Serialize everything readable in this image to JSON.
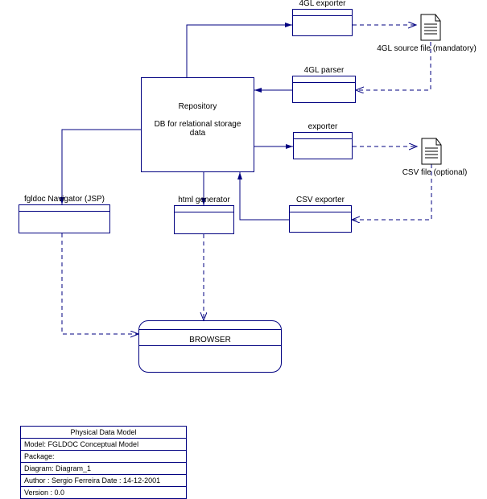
{
  "components": {
    "fourgl_exporter": "4GL exporter",
    "fourgl_parser": "4GL parser",
    "exporter": "exporter",
    "csv_exporter": "CSV exporter",
    "html_generator": "html generator",
    "fgldoc_navigator": "fgldoc Navigator (JSP)"
  },
  "repository": {
    "title": "Repository",
    "subtitle": "DB for relational storage data"
  },
  "files": {
    "fourgl_source": "4GL source file (mandatory)",
    "csv_file": "CSV file (optional)"
  },
  "browser": "BROWSER",
  "metadata": {
    "title": "Physical Data Model",
    "model": "Model: FGLDOC Conceptual Model",
    "package": "Package:",
    "diagram": "Diagram: Diagram_1",
    "author_date": "Author : Sergio Ferreira    Date : 14-12-2001",
    "version": "Version : 0.0"
  },
  "chart_data": {
    "type": "diagram",
    "title": "Physical Data Model — FGLDOC Conceptual Model",
    "nodes": [
      {
        "id": "repository",
        "label": "Repository — DB for relational storage data",
        "kind": "datastore"
      },
      {
        "id": "fourgl_exporter",
        "label": "4GL exporter",
        "kind": "component"
      },
      {
        "id": "fourgl_parser",
        "label": "4GL parser",
        "kind": "component"
      },
      {
        "id": "exporter",
        "label": "exporter",
        "kind": "component"
      },
      {
        "id": "csv_exporter",
        "label": "CSV exporter",
        "kind": "component"
      },
      {
        "id": "html_generator",
        "label": "html generator",
        "kind": "component"
      },
      {
        "id": "fgldoc_navigator",
        "label": "fgldoc Navigator (JSP)",
        "kind": "component"
      },
      {
        "id": "fourgl_source_file",
        "label": "4GL source file (mandatory)",
        "kind": "artifact"
      },
      {
        "id": "csv_file",
        "label": "CSV file (optional)",
        "kind": "artifact"
      },
      {
        "id": "browser",
        "label": "BROWSER",
        "kind": "node"
      }
    ],
    "edges": [
      {
        "from": "repository",
        "to": "fourgl_exporter",
        "style": "solid"
      },
      {
        "from": "fourgl_exporter",
        "to": "fourgl_source_file",
        "style": "dashed"
      },
      {
        "from": "fourgl_source_file",
        "to": "fourgl_parser",
        "style": "dashed"
      },
      {
        "from": "fourgl_parser",
        "to": "repository",
        "style": "solid"
      },
      {
        "from": "repository",
        "to": "exporter",
        "style": "solid"
      },
      {
        "from": "exporter",
        "to": "csv_file",
        "style": "dashed"
      },
      {
        "from": "csv_file",
        "to": "csv_exporter",
        "style": "dashed"
      },
      {
        "from": "csv_exporter",
        "to": "repository",
        "style": "solid"
      },
      {
        "from": "repository",
        "to": "html_generator",
        "style": "solid"
      },
      {
        "from": "repository",
        "to": "fgldoc_navigator",
        "style": "solid"
      },
      {
        "from": "fgldoc_navigator",
        "to": "browser",
        "style": "dashed"
      },
      {
        "from": "html_generator",
        "to": "browser",
        "style": "dashed"
      }
    ]
  }
}
